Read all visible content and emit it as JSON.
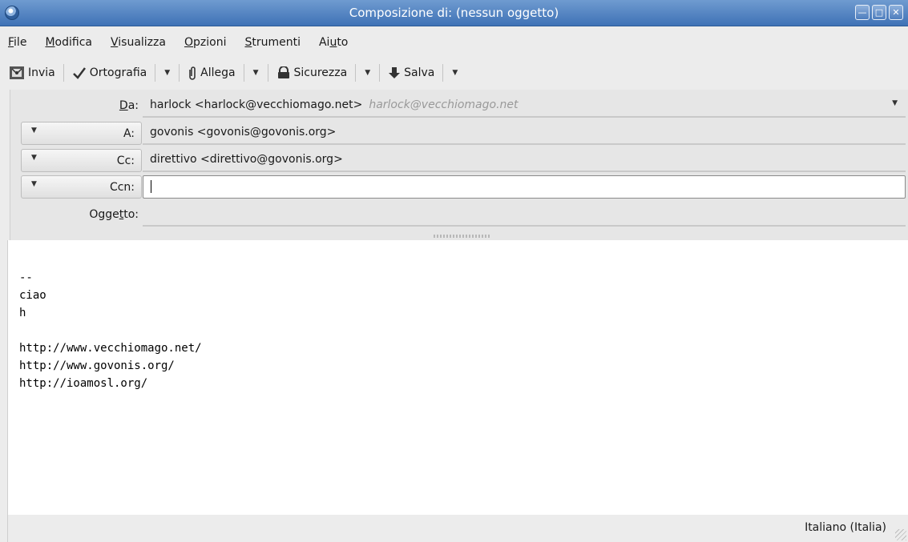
{
  "window": {
    "title": "Composizione di: (nessun oggetto)",
    "icon": "thunderbird-icon",
    "controls": [
      "minimize-icon",
      "maximize-icon",
      "close-icon"
    ]
  },
  "menu": [
    {
      "pre": "",
      "ul": "F",
      "post": "ile"
    },
    {
      "pre": "",
      "ul": "M",
      "post": "odifica"
    },
    {
      "pre": "",
      "ul": "V",
      "post": "isualizza"
    },
    {
      "pre": "",
      "ul": "O",
      "post": "pzioni"
    },
    {
      "pre": "",
      "ul": "S",
      "post": "trumenti"
    },
    {
      "pre": "Ai",
      "ul": "u",
      "post": "to"
    }
  ],
  "toolbar": {
    "send_label": "Invia",
    "spell_label": "Ortografia",
    "attach_label": "Allega",
    "security_label": "Sicurezza",
    "save_label": "Salva"
  },
  "headers": {
    "from": {
      "label_pre": "",
      "label_ul": "D",
      "label_post": "a:",
      "value": "harlock <harlock@vecchiomago.net>",
      "identity": "harlock@vecchiomago.net"
    },
    "to": {
      "label": "A:",
      "value": "govonis <govonis@govonis.org>"
    },
    "cc": {
      "label": "Cc:",
      "value": "direttivo <direttivo@govonis.org>"
    },
    "bcc": {
      "label": "Ccn:",
      "value": ""
    },
    "subject": {
      "label_pre": "Ogge",
      "label_ul": "t",
      "label_post": "to:",
      "value": ""
    }
  },
  "body": {
    "lines": [
      "--",
      "ciao",
      "h",
      "",
      "http://www.vecchiomago.net/",
      "http://www.govonis.org/",
      "http://ioamosl.org/"
    ]
  },
  "status": {
    "language": "Italiano (Italia)"
  }
}
